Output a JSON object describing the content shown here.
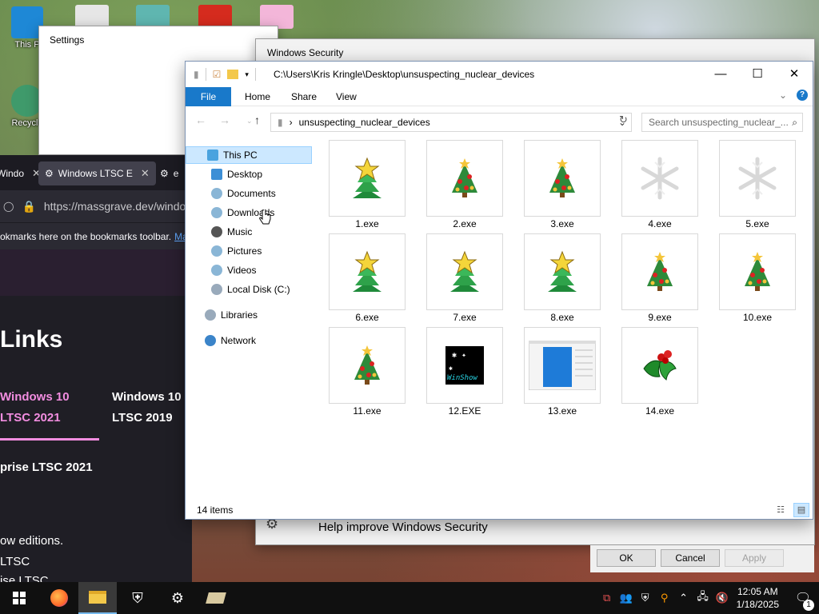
{
  "desktop": {
    "icons": [
      {
        "label": "This P"
      },
      {
        "label": "Recycle"
      }
    ]
  },
  "settings_window": {
    "title": "Settings"
  },
  "browser": {
    "tabs": [
      {
        "label": "Windo"
      },
      {
        "label": "Windows LTSC E"
      },
      {
        "label": "e"
      }
    ],
    "url": "https://massgrave.dev/windo",
    "bookmarks_text": "okmarks here on the bookmarks toolbar.",
    "bookmarks_link": "Ma",
    "page": {
      "heading": "Links",
      "edition_1": "Windows 10\nLTSC 2021",
      "edition_2": "Windows 10\nLTSC 2019",
      "enterprise": "prise LTSC 2021",
      "para_1": "ow editions.",
      "para_2": "LTSC",
      "para_3": "ise LTSC"
    }
  },
  "security_window": {
    "title": "Windows Security",
    "help_text": "Help improve Windows Security",
    "buttons": {
      "ok": "OK",
      "cancel": "Cancel",
      "apply": "Apply"
    }
  },
  "explorer": {
    "title_path": "C:\\Users\\Kris Kringle\\Desktop\\unsuspecting_nuclear_devices",
    "ribbon_tabs": [
      "File",
      "Home",
      "Share",
      "View"
    ],
    "address_folder": "unsuspecting_nuclear_devices",
    "search_placeholder": "Search unsuspecting_nuclear_...",
    "nav": [
      {
        "label": "This PC",
        "selected": true,
        "icon": "pc-icon"
      },
      {
        "label": "Desktop",
        "icon": "desktop-icon"
      },
      {
        "label": "Documents",
        "icon": "documents-icon"
      },
      {
        "label": "Downloads",
        "icon": "downloads-icon"
      },
      {
        "label": "Music",
        "icon": "music-icon"
      },
      {
        "label": "Pictures",
        "icon": "pictures-icon"
      },
      {
        "label": "Videos",
        "icon": "videos-icon"
      },
      {
        "label": "Local Disk (C:)",
        "icon": "drive-icon"
      },
      {
        "label": "Libraries",
        "icon": "libraries-icon"
      },
      {
        "label": "Network",
        "icon": "network-icon"
      }
    ],
    "files": [
      {
        "name": "1.exe",
        "icon": "star-tree"
      },
      {
        "name": "2.exe",
        "icon": "xmas-tree"
      },
      {
        "name": "3.exe",
        "icon": "xmas-tree"
      },
      {
        "name": "4.exe",
        "icon": "snowflake"
      },
      {
        "name": "5.exe",
        "icon": "snowflake"
      },
      {
        "name": "6.exe",
        "icon": "star-tree"
      },
      {
        "name": "7.exe",
        "icon": "star-tree"
      },
      {
        "name": "8.exe",
        "icon": "star-tree"
      },
      {
        "name": "9.exe",
        "icon": "xmas-tree"
      },
      {
        "name": "10.exe",
        "icon": "xmas-tree"
      },
      {
        "name": "11.exe",
        "icon": "xmas-tree"
      },
      {
        "name": "12.EXE",
        "icon": "winshow"
      },
      {
        "name": "13.exe",
        "icon": "window-app"
      },
      {
        "name": "14.exe",
        "icon": "holly"
      }
    ],
    "status": "14 items"
  },
  "taskbar": {
    "apps": [
      "start-icon",
      "firefox-icon",
      "file-explorer-icon",
      "windows-security-icon",
      "settings-icon",
      "misc-app-icon"
    ],
    "time": "12:05 AM",
    "date": "1/18/2025",
    "notification_count": "1"
  },
  "colors": {
    "accent": "#1979ca",
    "selection": "#cce8ff",
    "taskbar": "#101010",
    "browser_pink": "#f28de0"
  }
}
